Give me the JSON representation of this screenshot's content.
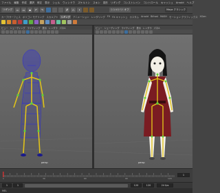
{
  "menu": {
    "items": [
      "ファイル",
      "編集",
      "作成",
      "選択",
      "修正",
      "表示",
      "シェル",
      "ウィンドウ",
      "スケルトン",
      "スキン",
      "変形",
      "リギング",
      "コンストレイン",
      "コントロール",
      "キャッシュ",
      "Arnold",
      "ヘルプ"
    ]
  },
  "toolbar": {
    "mode_select": "リギング",
    "workspace_select": "Maya クラシック",
    "symmetry_label": "シンメトリ: オフ"
  },
  "shelf": {
    "tabs": [
      "カーブ/サーフェス",
      "ポリゴン モデリング",
      "スカルプト",
      "リギング",
      "アニメーション",
      "レンダリング",
      "FX",
      "FX キャッシュ",
      "カスタム",
      "Arnold",
      "Bifrost",
      "MASH",
      "モーション グラフィックス",
      "XGen"
    ],
    "active_tab": "リギング"
  },
  "left_panel": {
    "menu": [
      "ビュー",
      "シェーディング",
      "ライティング",
      "表示",
      "レンダラ",
      "パネル"
    ],
    "camera_label": "persp"
  },
  "right_panel": {
    "menu": [
      "ビュー",
      "シェーディング",
      "ライティング",
      "表示",
      "レンダラ",
      "パネル"
    ],
    "camera_label": "persp"
  },
  "timeline": {
    "tick_labels": [
      "1",
      "5",
      "10",
      "15",
      "20",
      "25",
      "30",
      "35",
      "40",
      "45",
      "50",
      "55",
      "60",
      "65",
      "70",
      "75",
      "80",
      "85",
      "90",
      "95",
      "100",
      "105",
      "110",
      "115",
      "120"
    ],
    "current_frame": "1"
  },
  "range": {
    "start": "1",
    "inner_start": "1",
    "inner_end": "120",
    "end": "120",
    "fps": "24 fps"
  },
  "status": {
    "text": "MEL"
  },
  "colors": {
    "wire_blue": "#2a2ad8",
    "joint_yellow": "#e0c21a",
    "joint_green": "#5ed13a",
    "dress_red": "#7a1c22",
    "skin": "#f2efe6"
  }
}
